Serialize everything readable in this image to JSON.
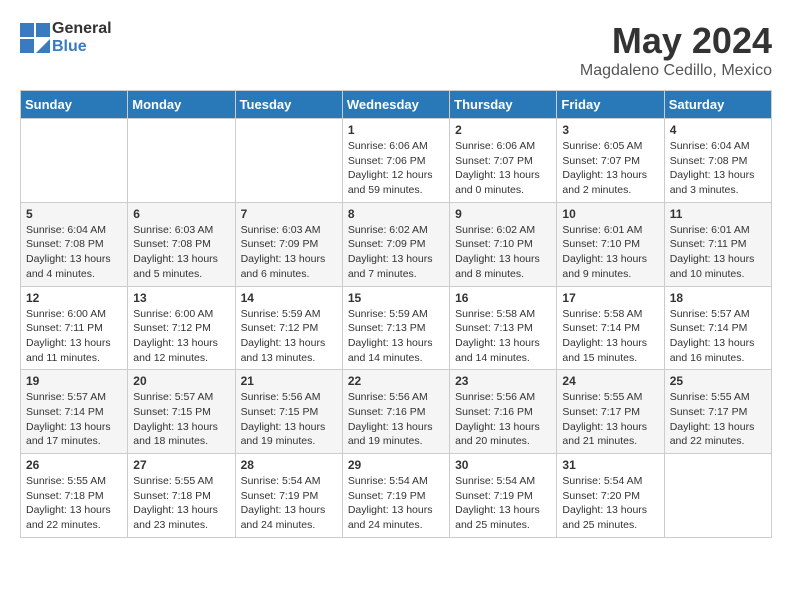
{
  "header": {
    "logo_general": "General",
    "logo_blue": "Blue",
    "month": "May 2024",
    "location": "Magdaleno Cedillo, Mexico"
  },
  "days_of_week": [
    "Sunday",
    "Monday",
    "Tuesday",
    "Wednesday",
    "Thursday",
    "Friday",
    "Saturday"
  ],
  "weeks": [
    [
      {
        "day": "",
        "sunrise": "",
        "sunset": "",
        "daylight": ""
      },
      {
        "day": "",
        "sunrise": "",
        "sunset": "",
        "daylight": ""
      },
      {
        "day": "",
        "sunrise": "",
        "sunset": "",
        "daylight": ""
      },
      {
        "day": "1",
        "sunrise": "Sunrise: 6:06 AM",
        "sunset": "Sunset: 7:06 PM",
        "daylight": "Daylight: 12 hours and 59 minutes."
      },
      {
        "day": "2",
        "sunrise": "Sunrise: 6:06 AM",
        "sunset": "Sunset: 7:07 PM",
        "daylight": "Daylight: 13 hours and 0 minutes."
      },
      {
        "day": "3",
        "sunrise": "Sunrise: 6:05 AM",
        "sunset": "Sunset: 7:07 PM",
        "daylight": "Daylight: 13 hours and 2 minutes."
      },
      {
        "day": "4",
        "sunrise": "Sunrise: 6:04 AM",
        "sunset": "Sunset: 7:08 PM",
        "daylight": "Daylight: 13 hours and 3 minutes."
      }
    ],
    [
      {
        "day": "5",
        "sunrise": "Sunrise: 6:04 AM",
        "sunset": "Sunset: 7:08 PM",
        "daylight": "Daylight: 13 hours and 4 minutes."
      },
      {
        "day": "6",
        "sunrise": "Sunrise: 6:03 AM",
        "sunset": "Sunset: 7:08 PM",
        "daylight": "Daylight: 13 hours and 5 minutes."
      },
      {
        "day": "7",
        "sunrise": "Sunrise: 6:03 AM",
        "sunset": "Sunset: 7:09 PM",
        "daylight": "Daylight: 13 hours and 6 minutes."
      },
      {
        "day": "8",
        "sunrise": "Sunrise: 6:02 AM",
        "sunset": "Sunset: 7:09 PM",
        "daylight": "Daylight: 13 hours and 7 minutes."
      },
      {
        "day": "9",
        "sunrise": "Sunrise: 6:02 AM",
        "sunset": "Sunset: 7:10 PM",
        "daylight": "Daylight: 13 hours and 8 minutes."
      },
      {
        "day": "10",
        "sunrise": "Sunrise: 6:01 AM",
        "sunset": "Sunset: 7:10 PM",
        "daylight": "Daylight: 13 hours and 9 minutes."
      },
      {
        "day": "11",
        "sunrise": "Sunrise: 6:01 AM",
        "sunset": "Sunset: 7:11 PM",
        "daylight": "Daylight: 13 hours and 10 minutes."
      }
    ],
    [
      {
        "day": "12",
        "sunrise": "Sunrise: 6:00 AM",
        "sunset": "Sunset: 7:11 PM",
        "daylight": "Daylight: 13 hours and 11 minutes."
      },
      {
        "day": "13",
        "sunrise": "Sunrise: 6:00 AM",
        "sunset": "Sunset: 7:12 PM",
        "daylight": "Daylight: 13 hours and 12 minutes."
      },
      {
        "day": "14",
        "sunrise": "Sunrise: 5:59 AM",
        "sunset": "Sunset: 7:12 PM",
        "daylight": "Daylight: 13 hours and 13 minutes."
      },
      {
        "day": "15",
        "sunrise": "Sunrise: 5:59 AM",
        "sunset": "Sunset: 7:13 PM",
        "daylight": "Daylight: 13 hours and 14 minutes."
      },
      {
        "day": "16",
        "sunrise": "Sunrise: 5:58 AM",
        "sunset": "Sunset: 7:13 PM",
        "daylight": "Daylight: 13 hours and 14 minutes."
      },
      {
        "day": "17",
        "sunrise": "Sunrise: 5:58 AM",
        "sunset": "Sunset: 7:14 PM",
        "daylight": "Daylight: 13 hours and 15 minutes."
      },
      {
        "day": "18",
        "sunrise": "Sunrise: 5:57 AM",
        "sunset": "Sunset: 7:14 PM",
        "daylight": "Daylight: 13 hours and 16 minutes."
      }
    ],
    [
      {
        "day": "19",
        "sunrise": "Sunrise: 5:57 AM",
        "sunset": "Sunset: 7:14 PM",
        "daylight": "Daylight: 13 hours and 17 minutes."
      },
      {
        "day": "20",
        "sunrise": "Sunrise: 5:57 AM",
        "sunset": "Sunset: 7:15 PM",
        "daylight": "Daylight: 13 hours and 18 minutes."
      },
      {
        "day": "21",
        "sunrise": "Sunrise: 5:56 AM",
        "sunset": "Sunset: 7:15 PM",
        "daylight": "Daylight: 13 hours and 19 minutes."
      },
      {
        "day": "22",
        "sunrise": "Sunrise: 5:56 AM",
        "sunset": "Sunset: 7:16 PM",
        "daylight": "Daylight: 13 hours and 19 minutes."
      },
      {
        "day": "23",
        "sunrise": "Sunrise: 5:56 AM",
        "sunset": "Sunset: 7:16 PM",
        "daylight": "Daylight: 13 hours and 20 minutes."
      },
      {
        "day": "24",
        "sunrise": "Sunrise: 5:55 AM",
        "sunset": "Sunset: 7:17 PM",
        "daylight": "Daylight: 13 hours and 21 minutes."
      },
      {
        "day": "25",
        "sunrise": "Sunrise: 5:55 AM",
        "sunset": "Sunset: 7:17 PM",
        "daylight": "Daylight: 13 hours and 22 minutes."
      }
    ],
    [
      {
        "day": "26",
        "sunrise": "Sunrise: 5:55 AM",
        "sunset": "Sunset: 7:18 PM",
        "daylight": "Daylight: 13 hours and 22 minutes."
      },
      {
        "day": "27",
        "sunrise": "Sunrise: 5:55 AM",
        "sunset": "Sunset: 7:18 PM",
        "daylight": "Daylight: 13 hours and 23 minutes."
      },
      {
        "day": "28",
        "sunrise": "Sunrise: 5:54 AM",
        "sunset": "Sunset: 7:19 PM",
        "daylight": "Daylight: 13 hours and 24 minutes."
      },
      {
        "day": "29",
        "sunrise": "Sunrise: 5:54 AM",
        "sunset": "Sunset: 7:19 PM",
        "daylight": "Daylight: 13 hours and 24 minutes."
      },
      {
        "day": "30",
        "sunrise": "Sunrise: 5:54 AM",
        "sunset": "Sunset: 7:19 PM",
        "daylight": "Daylight: 13 hours and 25 minutes."
      },
      {
        "day": "31",
        "sunrise": "Sunrise: 5:54 AM",
        "sunset": "Sunset: 7:20 PM",
        "daylight": "Daylight: 13 hours and 25 minutes."
      },
      {
        "day": "",
        "sunrise": "",
        "sunset": "",
        "daylight": ""
      }
    ]
  ]
}
